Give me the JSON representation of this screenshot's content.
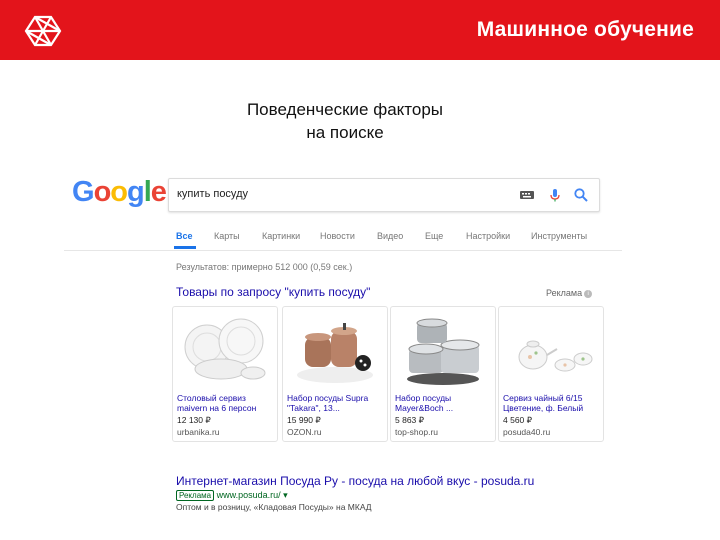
{
  "slide": {
    "title": "Машинное обучение",
    "subtitle_line1": "Поведенческие факторы",
    "subtitle_line2": "на поиске"
  },
  "colors": {
    "topbar": "#e3141b",
    "google_blue": "#4285f4",
    "google_red": "#ea4335",
    "google_yellow": "#fbbc05",
    "google_green": "#34a853",
    "link": "#1a0dab",
    "url_green": "#006621"
  },
  "google": {
    "logo": [
      "G",
      "o",
      "o",
      "g",
      "l",
      "e"
    ],
    "query": "купить посуду",
    "icons": [
      "keyboard-icon",
      "mic-icon",
      "search-icon"
    ],
    "tabs": [
      {
        "label": "Все",
        "active": true
      },
      {
        "label": "Карты"
      },
      {
        "label": "Картинки"
      },
      {
        "label": "Новости"
      },
      {
        "label": "Видео"
      },
      {
        "label": "Еще"
      },
      {
        "label": "Настройки"
      },
      {
        "label": "Инструменты"
      }
    ],
    "stats": "Результатов: примерно 512 000 (0,59 сек.)",
    "shopping": {
      "heading": "Товары по запросу \"купить посуду\"",
      "ad_label": "Реклама",
      "ad_info_icon": "info-icon",
      "products": [
        {
          "name": "Столовый сервиз maivern на 6 персон",
          "price": "12 130 ₽",
          "store": "urbanika.ru"
        },
        {
          "name": "Набор посуды Supra \"Takara\", 13...",
          "price": "15 990 ₽",
          "store": "OZON.ru"
        },
        {
          "name": "Набор посуды Mayer&Boch ...",
          "price": "5 863 ₽",
          "store": "top-shop.ru"
        },
        {
          "name": "Сервиз чайный 6/15 Цветение, ф. Белый",
          "price": "4 560 ₽",
          "store": "posuda40.ru"
        }
      ]
    },
    "result": {
      "title": "Интернет-магазин Посуда Ру - посуда на любой вкус - posuda.ru",
      "ad_badge": "Реклама",
      "url": "www.posuda.ru/",
      "dropdown_icon": "▾",
      "description": "Оптом и в розницу, «Кладовая Посуды» на МКАД"
    }
  }
}
